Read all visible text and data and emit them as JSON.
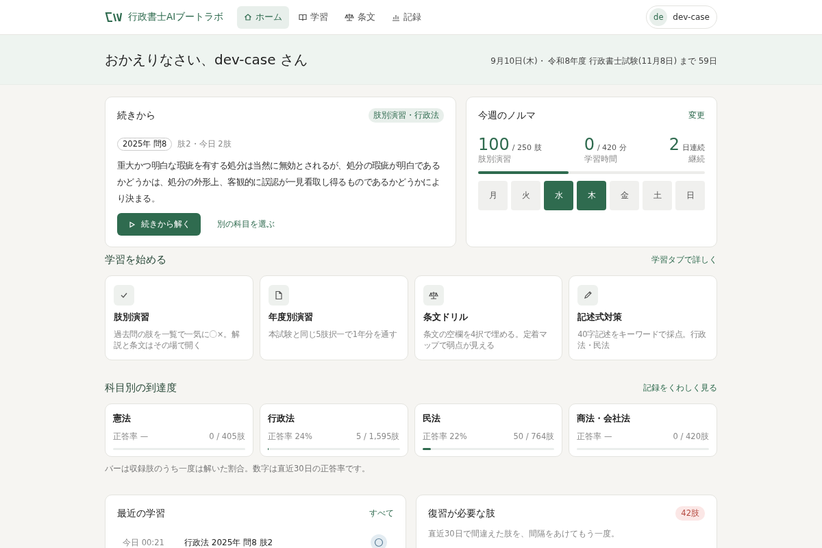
{
  "header": {
    "brand": "行政書士AIブートラボ",
    "nav": [
      {
        "label": "ホーム",
        "selected": true
      },
      {
        "label": "学習",
        "selected": false
      },
      {
        "label": "条文",
        "selected": false
      },
      {
        "label": "記録",
        "selected": false
      }
    ],
    "user": {
      "initials": "de",
      "name": "dev-case"
    }
  },
  "greeting": {
    "title": "おかえりなさい、dev-case さん",
    "info": "9月10日(木)・ 令和8年度 行政書士試験(11月8日) まで 59日"
  },
  "continue": {
    "title": "続きから",
    "tag": "肢別演習・行政法",
    "question": "2025年 問8",
    "meta": "肢2・今日 2肢",
    "text": "重大かつ明白な瑕疵を有する処分は当然に無効とされるが、処分の瑕疵が明白であるかどうかは、処分の外形上、客観的に誤認が一見看取し得るものであるかどうかにより決まる。",
    "primary": "続きから解く",
    "secondary": "別の科目を選ぶ"
  },
  "quota": {
    "title": "今週のノルマ",
    "edit": "変更",
    "stats": [
      {
        "value": "100",
        "unit": "/ 250 肢",
        "label": "肢別演習"
      },
      {
        "value": "0",
        "unit": "/ 420 分",
        "label": "学習時間"
      },
      {
        "value": "2",
        "unit": "日連続",
        "label": "継続"
      }
    ],
    "level": 0.4,
    "days": [
      {
        "label": "月",
        "done": false
      },
      {
        "label": "火",
        "done": false
      },
      {
        "label": "水",
        "done": true
      },
      {
        "label": "木",
        "done": true
      },
      {
        "label": "金",
        "done": false
      },
      {
        "label": "土",
        "done": false
      },
      {
        "label": "日",
        "done": false
      }
    ]
  },
  "start": {
    "title": "学習を始める",
    "link": "学習タブで詳しく",
    "modes": [
      {
        "title": "肢別演習",
        "desc": "過去問の肢を一覧で一気に〇×。解説と条文はその場で開く"
      },
      {
        "title": "年度別演習",
        "desc": "本試験と同じ5肢択一で1年分を通す"
      },
      {
        "title": "条文ドリル",
        "desc": "条文の空欄を4択で埋める。定着マップで弱点が見える"
      },
      {
        "title": "記述式対策",
        "desc": "40字記述をキーワードで採点。行政法・民法"
      }
    ]
  },
  "progress": {
    "title": "科目別の到達度",
    "link": "記録をくわしく見る",
    "subjects": [
      {
        "name": "憲法",
        "rate": "正答率 —",
        "count": "0 / 405肢",
        "level": 0
      },
      {
        "name": "行政法",
        "rate": "正答率 24%",
        "count": "5 / 1,595肢",
        "level": 0.003
      },
      {
        "name": "民法",
        "rate": "正答率 22%",
        "count": "50 / 764肢",
        "level": 0.065
      },
      {
        "name": "商法・会社法",
        "rate": "正答率 —",
        "count": "0 / 420肢",
        "level": 0
      }
    ],
    "note": "バーは収録肢のうち一度は解いた割合。数字は直近30日の正答率です。"
  },
  "recent": {
    "title": "最近の学習",
    "link": "すべて",
    "items": [
      {
        "time": "今日 00:21",
        "label": "行政法 2025年 問8 肢2"
      }
    ]
  },
  "review": {
    "title": "復習が必要な肢",
    "badge": "42肢",
    "desc": "直近30日で間違えた肢を、間隔をあけてもう一度。"
  }
}
